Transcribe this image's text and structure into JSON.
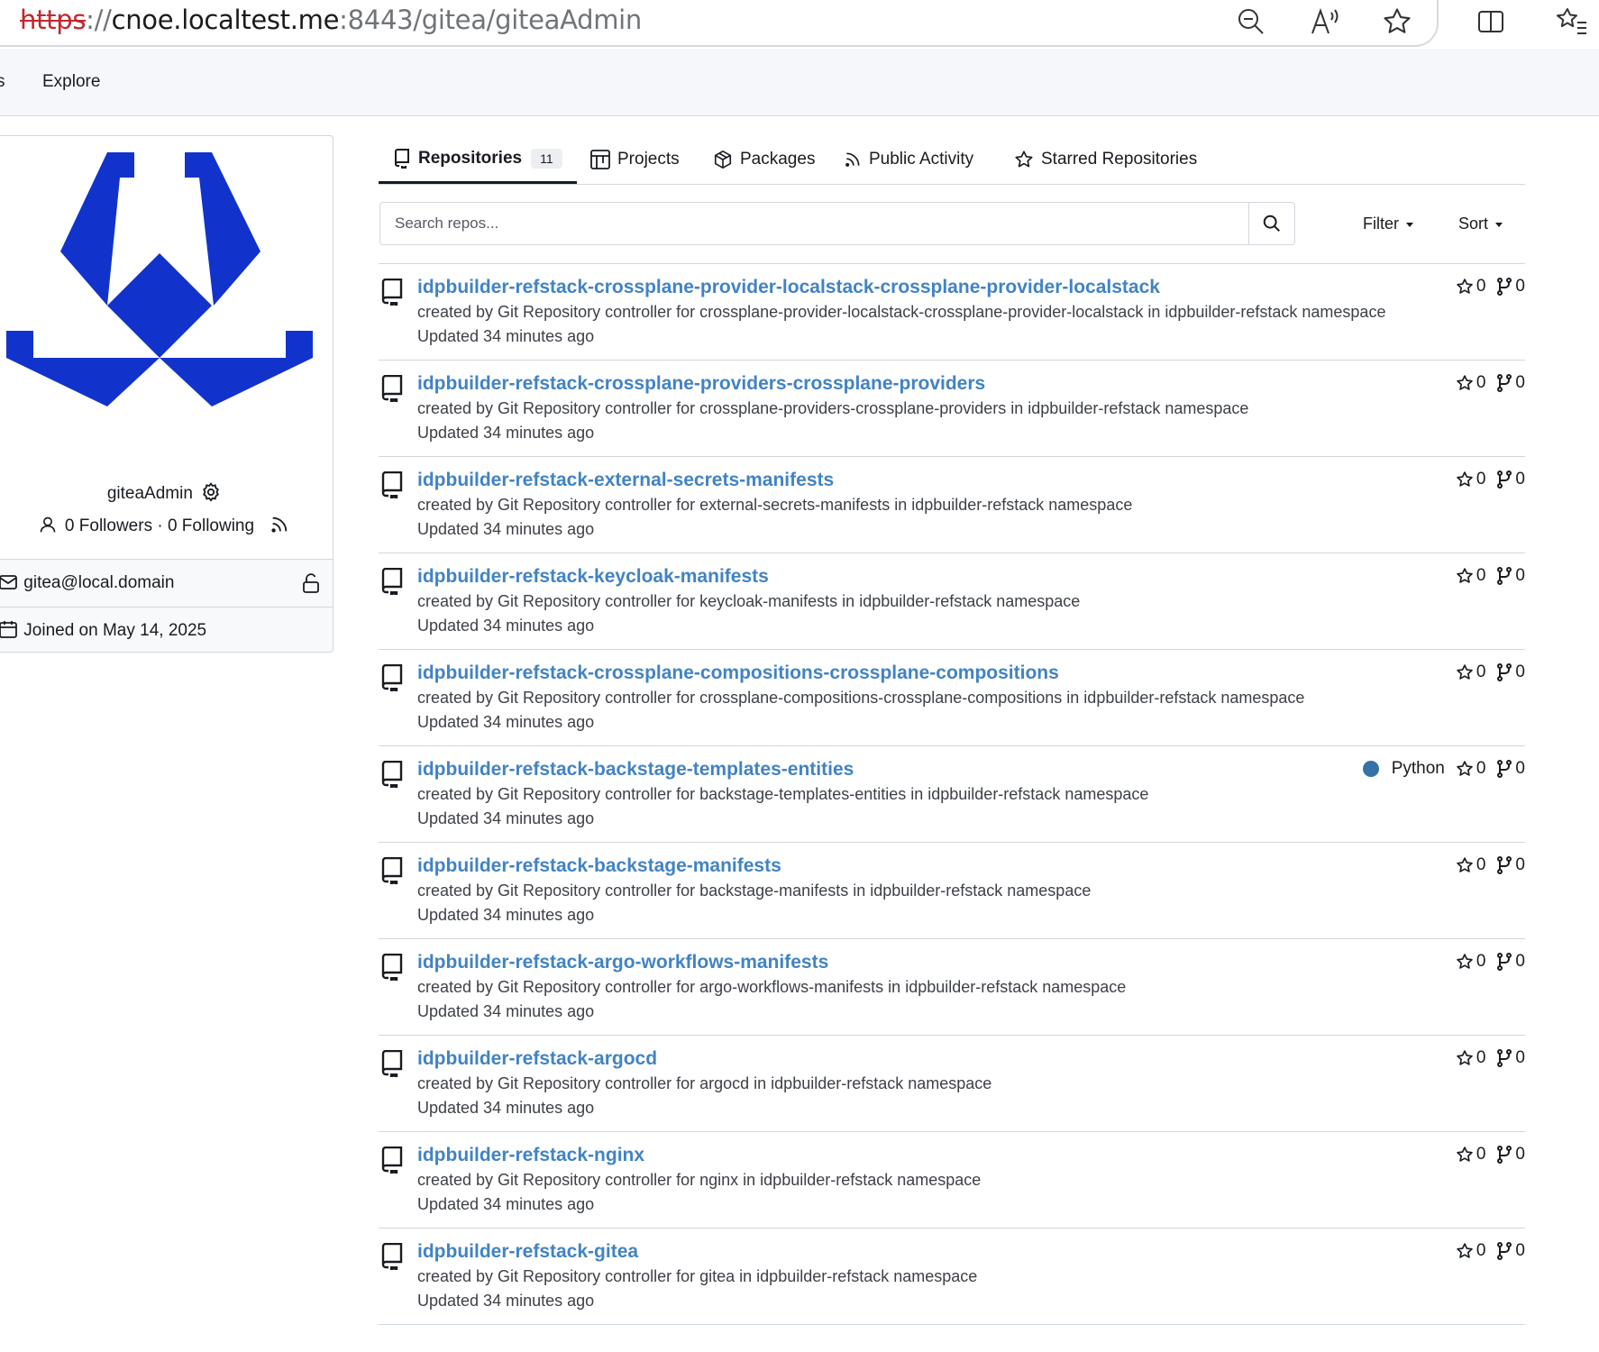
{
  "browser": {
    "url_scheme": "https",
    "url_separator": "://",
    "url_host": "cnoe.localtest.me",
    "url_path": ":8443/gitea/giteaAdmin"
  },
  "navbar": {
    "items": [
      {
        "label": "s"
      },
      {
        "label": "Explore"
      }
    ]
  },
  "profile": {
    "username": "giteaAdmin",
    "followers_text": "0 Followers · 0 Following",
    "email": "gitea@local.domain",
    "joined": "Joined on May 14, 2025",
    "avatar_color": "#1133cc"
  },
  "tabs": [
    {
      "label": "Repositories",
      "count": "11",
      "icon": "repo-icon",
      "active": true
    },
    {
      "label": "Projects",
      "icon": "project-icon"
    },
    {
      "label": "Packages",
      "icon": "package-icon"
    },
    {
      "label": "Public Activity",
      "icon": "rss-icon"
    },
    {
      "label": "Starred Repositories",
      "icon": "star-icon"
    }
  ],
  "search": {
    "placeholder": "Search repos...",
    "filter_label": "Filter",
    "sort_label": "Sort"
  },
  "colors": {
    "link": "#4183c4",
    "python": "#3572a5"
  },
  "repos": [
    {
      "name": "idpbuilder-refstack-crossplane-provider-localstack-crossplane-provider-localstack",
      "description": "created by Git Repository controller for crossplane-provider-localstack-crossplane-provider-localstack in idpbuilder-refstack namespace",
      "updated": "Updated 34 minutes ago",
      "language": "",
      "stars": "0",
      "forks": "0"
    },
    {
      "name": "idpbuilder-refstack-crossplane-providers-crossplane-providers",
      "description": "created by Git Repository controller for crossplane-providers-crossplane-providers in idpbuilder-refstack namespace",
      "updated": "Updated 34 minutes ago",
      "language": "",
      "stars": "0",
      "forks": "0"
    },
    {
      "name": "idpbuilder-refstack-external-secrets-manifests",
      "description": "created by Git Repository controller for external-secrets-manifests in idpbuilder-refstack namespace",
      "updated": "Updated 34 minutes ago",
      "language": "",
      "stars": "0",
      "forks": "0"
    },
    {
      "name": "idpbuilder-refstack-keycloak-manifests",
      "description": "created by Git Repository controller for keycloak-manifests in idpbuilder-refstack namespace",
      "updated": "Updated 34 minutes ago",
      "language": "",
      "stars": "0",
      "forks": "0"
    },
    {
      "name": "idpbuilder-refstack-crossplane-compositions-crossplane-compositions",
      "description": "created by Git Repository controller for crossplane-compositions-crossplane-compositions in idpbuilder-refstack namespace",
      "updated": "Updated 34 minutes ago",
      "language": "",
      "stars": "0",
      "forks": "0"
    },
    {
      "name": "idpbuilder-refstack-backstage-templates-entities",
      "description": "created by Git Repository controller for backstage-templates-entities in idpbuilder-refstack namespace",
      "updated": "Updated 34 minutes ago",
      "language": "Python",
      "stars": "0",
      "forks": "0"
    },
    {
      "name": "idpbuilder-refstack-backstage-manifests",
      "description": "created by Git Repository controller for backstage-manifests in idpbuilder-refstack namespace",
      "updated": "Updated 34 minutes ago",
      "language": "",
      "stars": "0",
      "forks": "0"
    },
    {
      "name": "idpbuilder-refstack-argo-workflows-manifests",
      "description": "created by Git Repository controller for argo-workflows-manifests in idpbuilder-refstack namespace",
      "updated": "Updated 34 minutes ago",
      "language": "",
      "stars": "0",
      "forks": "0"
    },
    {
      "name": "idpbuilder-refstack-argocd",
      "description": "created by Git Repository controller for argocd in idpbuilder-refstack namespace",
      "updated": "Updated 34 minutes ago",
      "language": "",
      "stars": "0",
      "forks": "0"
    },
    {
      "name": "idpbuilder-refstack-nginx",
      "description": "created by Git Repository controller for nginx in idpbuilder-refstack namespace",
      "updated": "Updated 34 minutes ago",
      "language": "",
      "stars": "0",
      "forks": "0"
    },
    {
      "name": "idpbuilder-refstack-gitea",
      "description": "created by Git Repository controller for gitea in idpbuilder-refstack namespace",
      "updated": "Updated 34 minutes ago",
      "language": "",
      "stars": "0",
      "forks": "0"
    }
  ]
}
